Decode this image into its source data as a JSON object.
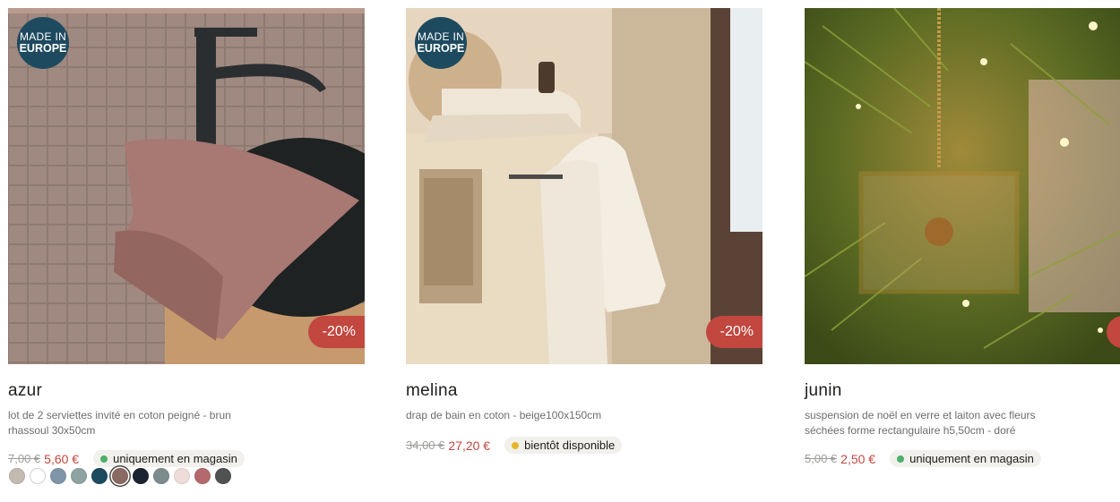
{
  "products": [
    {
      "badge": {
        "line1": "MADE IN",
        "line2": "EUROPE"
      },
      "discount": "-20%",
      "name": "azur",
      "description": "lot de 2 serviettes invité en coton peigné - brun rhassoul 30x50cm",
      "old_price": "7,00 €",
      "new_price": "5,60 €",
      "availability": "uniquement en magasin",
      "availability_color": "#4caf6a",
      "swatches": [
        "#c4bbb0",
        "#ffffff",
        "#7f96a8",
        "#8fa3a3",
        "#1e4a5f",
        "#8a6b63",
        "#1c2431",
        "#7c8c8e",
        "#eddcd8",
        "#b46a6c",
        "#4f5250"
      ],
      "selected_swatch": 5
    },
    {
      "badge": {
        "line1": "MADE IN",
        "line2": "EUROPE"
      },
      "discount": "-20%",
      "name": "melina",
      "description": "drap de bain en coton - beige100x150cm",
      "old_price": "34,00 €",
      "new_price": "27,20 €",
      "availability": "bientôt disponible",
      "availability_color": "#e5b62a"
    },
    {
      "discount": "-",
      "name": "junin",
      "description": "suspension de noël en verre et laiton avec fleurs séchées forme rectangulaire h5,50cm - doré",
      "old_price": "5,00 €",
      "new_price": "2,50 €",
      "availability": "uniquement en magasin",
      "availability_color": "#4caf6a"
    }
  ]
}
